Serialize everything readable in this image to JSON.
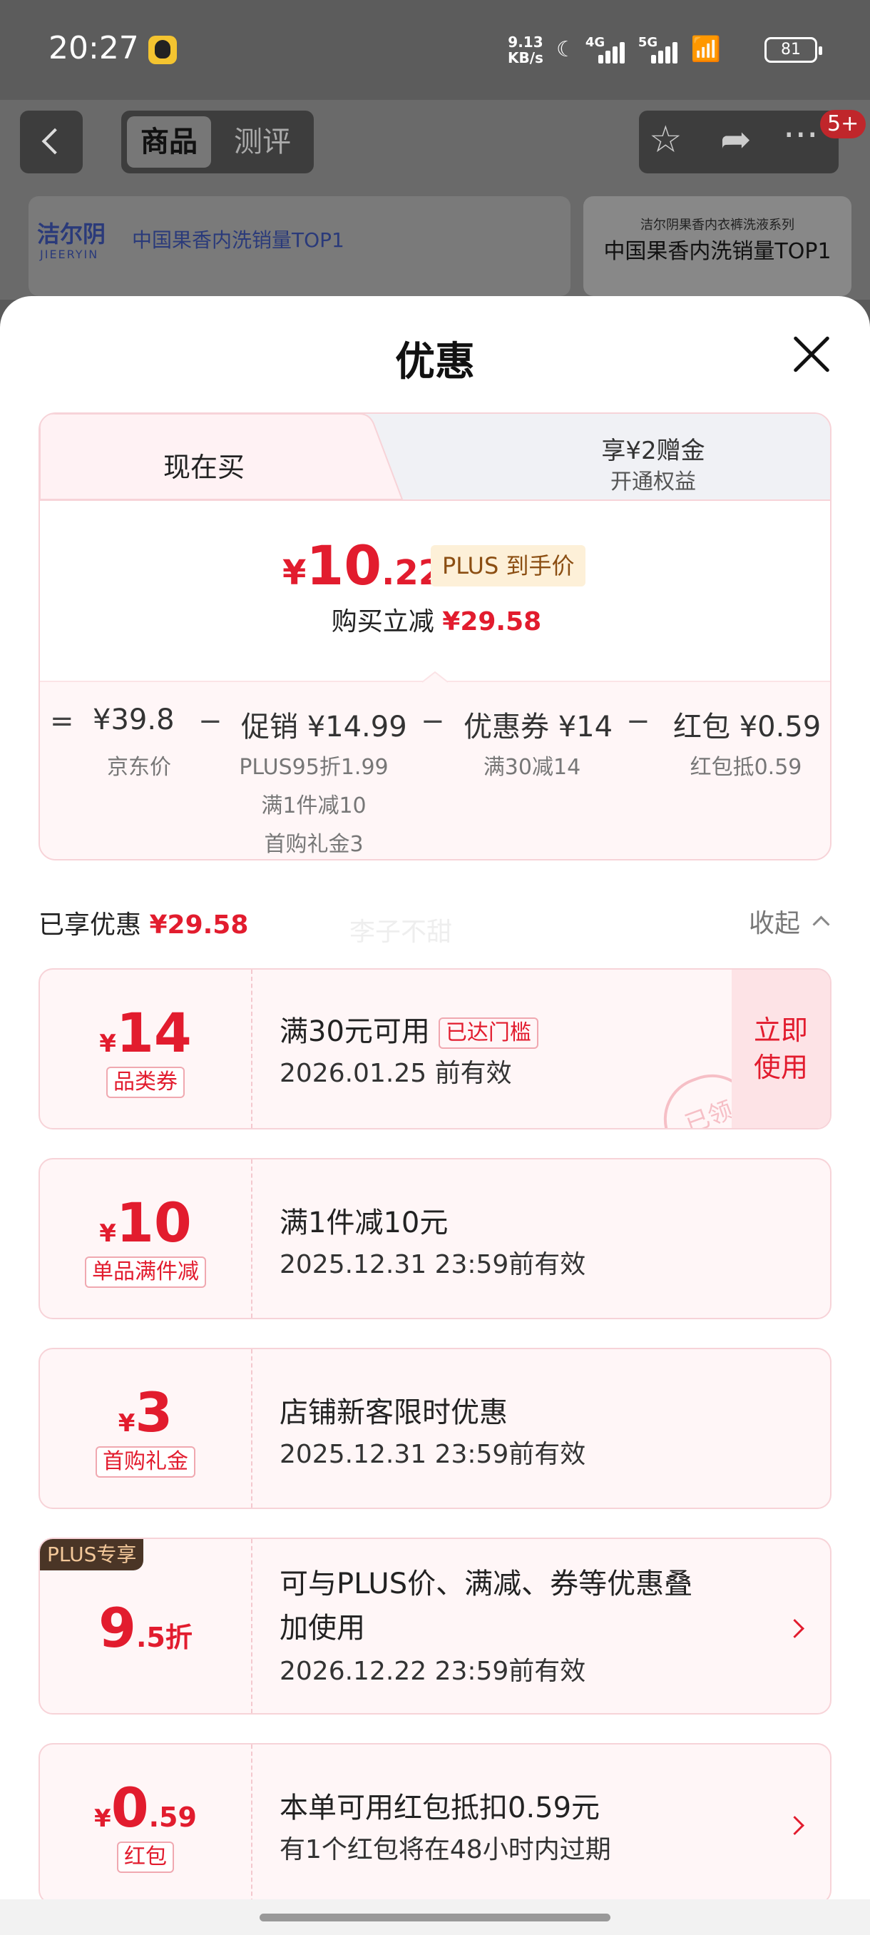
{
  "status_bar": {
    "time": "20:27",
    "net_speed_1": "9.13",
    "net_speed_2": "KB/s",
    "net1": "4G",
    "net2": "5G",
    "battery": "81"
  },
  "header": {
    "tab_product": "商品",
    "tab_review": "测评",
    "more_badge": "5+"
  },
  "banner": {
    "logo": "洁尔阴",
    "logo_en": "JIEERYIN",
    "left_text": "中国果香内洗销量TOP1",
    "right_small": "洁尔阴果香内衣裤洗液系列",
    "right_big": "中国果香内洗销量TOP1"
  },
  "sheet": {
    "title": "优惠",
    "tab_now": "现在买",
    "tab_plus_line1": "享¥2赠金",
    "tab_plus_line2": "开通权益",
    "price_yen": "¥",
    "price_int": "10",
    "price_dec": ".22",
    "plus_tag": "PLUS 到手价",
    "reduce_label": "购买立减",
    "reduce_amount": "¥29.58",
    "breakdown": {
      "eq": "=",
      "minus": "−",
      "jd_price": "¥39.8",
      "jd_price_label": "京东价",
      "promo": "促销 ¥14.99",
      "promo_sub1": "PLUS95折1.99",
      "promo_sub2": "满1件减10",
      "promo_sub3": "首购礼金3",
      "coupon": "优惠券 ¥14",
      "coupon_sub": "满30减14",
      "redpacket": "红包 ¥0.59",
      "redpacket_sub": "红包抵0.59"
    },
    "enjoyed_label": "已享优惠",
    "enjoyed_amount": "¥29.58",
    "collapse": "收起",
    "watermark": "李子不甜"
  },
  "coupons": [
    {
      "yen": "¥",
      "amount": "14",
      "tag": "品类券",
      "title": "满30元可用",
      "reached": "已达门槛",
      "expiry": "2026.01.25 前有效",
      "action": "立即使用",
      "stamp": "已领"
    },
    {
      "yen": "¥",
      "amount": "10",
      "tag": "单品满件减",
      "title": "满1件减10元",
      "expiry": "2025.12.31 23:59前有效"
    },
    {
      "yen": "¥",
      "amount": "3",
      "tag": "首购礼金",
      "title": "店铺新客限时优惠",
      "expiry": "2025.12.31 23:59前有效"
    },
    {
      "badge": "PLUS专享",
      "amount": "9",
      "amount_dec": ".5折",
      "title_l1": "可与PLUS价、满减、券等优惠叠",
      "title_l2": "加使用",
      "expiry": "2026.12.22 23:59前有效"
    },
    {
      "yen": "¥",
      "amount": "0",
      "amount_dec": ".59",
      "tag": "红包",
      "title": "本单可用红包抵扣0.59元",
      "expiry": "有1个红包将在48小时内过期"
    }
  ],
  "colors": {
    "accent": "#e21c2e",
    "plus_tag_bg": "#fdf0d8",
    "card_bg": "#fff6f7"
  }
}
